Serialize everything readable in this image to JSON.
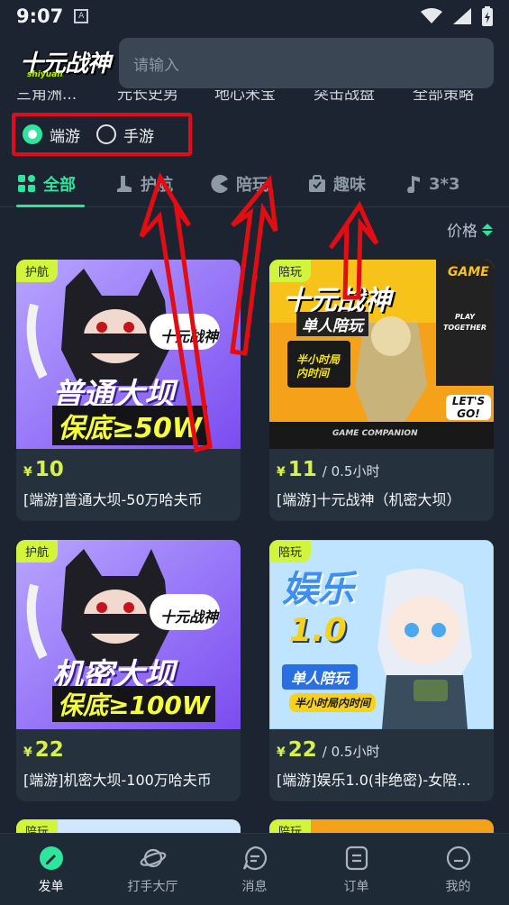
{
  "status_bar": {
    "time": "9:07",
    "notification_icon": "a-notification-icon"
  },
  "header": {
    "logo_text": "十元战神",
    "logo_subtext": "shiyuan",
    "search_placeholder": "请输入"
  },
  "peek_row": [
    "三角洲...",
    "元长史男",
    "地心米宝",
    "突击战盘",
    "全部策略"
  ],
  "filter": {
    "options": [
      {
        "label": "端游",
        "checked": true
      },
      {
        "label": "手游",
        "checked": false
      }
    ]
  },
  "tabs": [
    {
      "label": "全部",
      "icon": "grid-icon",
      "active": true
    },
    {
      "label": "护航",
      "icon": "boot-icon",
      "active": false
    },
    {
      "label": "陪玩",
      "icon": "pacman-icon",
      "active": false
    },
    {
      "label": "趣味",
      "icon": "bag-icon",
      "active": false
    },
    {
      "label": "3*3",
      "icon": "music-note-icon",
      "active": false
    }
  ],
  "sort": {
    "label": "价格"
  },
  "cards": [
    {
      "tag": "护航",
      "currency": "¥",
      "price": "10",
      "unit": "",
      "title": "[端游]普通大坝-50万哈夫币",
      "art_line1": "普通大坝",
      "art_line2": "保底≥50W",
      "art_badge": "十元战神"
    },
    {
      "tag": "陪玩",
      "currency": "¥",
      "price": "11",
      "unit": "/ 0.5小时",
      "title": "[端游]十元战神（机密大坝）",
      "art_line1": "十元战神",
      "art_line2": "单人陪玩",
      "art_badge": "半小时局内时间",
      "art_side1": "GAME",
      "art_side2": "PLAY TOGETHER",
      "art_side3": "LET'S GO!",
      "art_footer": "GAME COMPANION"
    },
    {
      "tag": "护航",
      "currency": "¥",
      "price": "22",
      "unit": "",
      "title": "[端游]机密大坝-100万哈夫币",
      "art_line1": "机密大坝",
      "art_line2": "保底≥100W",
      "art_badge": "十元战神"
    },
    {
      "tag": "陪玩",
      "currency": "¥",
      "price": "22",
      "unit": "/ 0.5小时",
      "title": "[端游]娱乐1.0(非绝密)-女陪...",
      "art_line1": "娱乐",
      "art_line2": "1.0",
      "art_badge": "单人陪玩",
      "art_footer": "半小时局内时间"
    },
    {
      "tag": "陪玩"
    },
    {
      "tag": "陪玩"
    }
  ],
  "bottom_nav": [
    {
      "label": "发单",
      "icon": "send-order-icon",
      "active": true
    },
    {
      "label": "打手大厅",
      "icon": "planet-icon",
      "active": false
    },
    {
      "label": "消息",
      "icon": "message-icon",
      "active": false
    },
    {
      "label": "订单",
      "icon": "order-icon",
      "active": false
    },
    {
      "label": "我的",
      "icon": "profile-icon",
      "active": false
    }
  ],
  "colors": {
    "accent": "#2ee59d",
    "price": "#d6f14a",
    "tag_bg": "#d2f53c",
    "annotation_red": "#e10d12",
    "background": "#1b2430"
  }
}
